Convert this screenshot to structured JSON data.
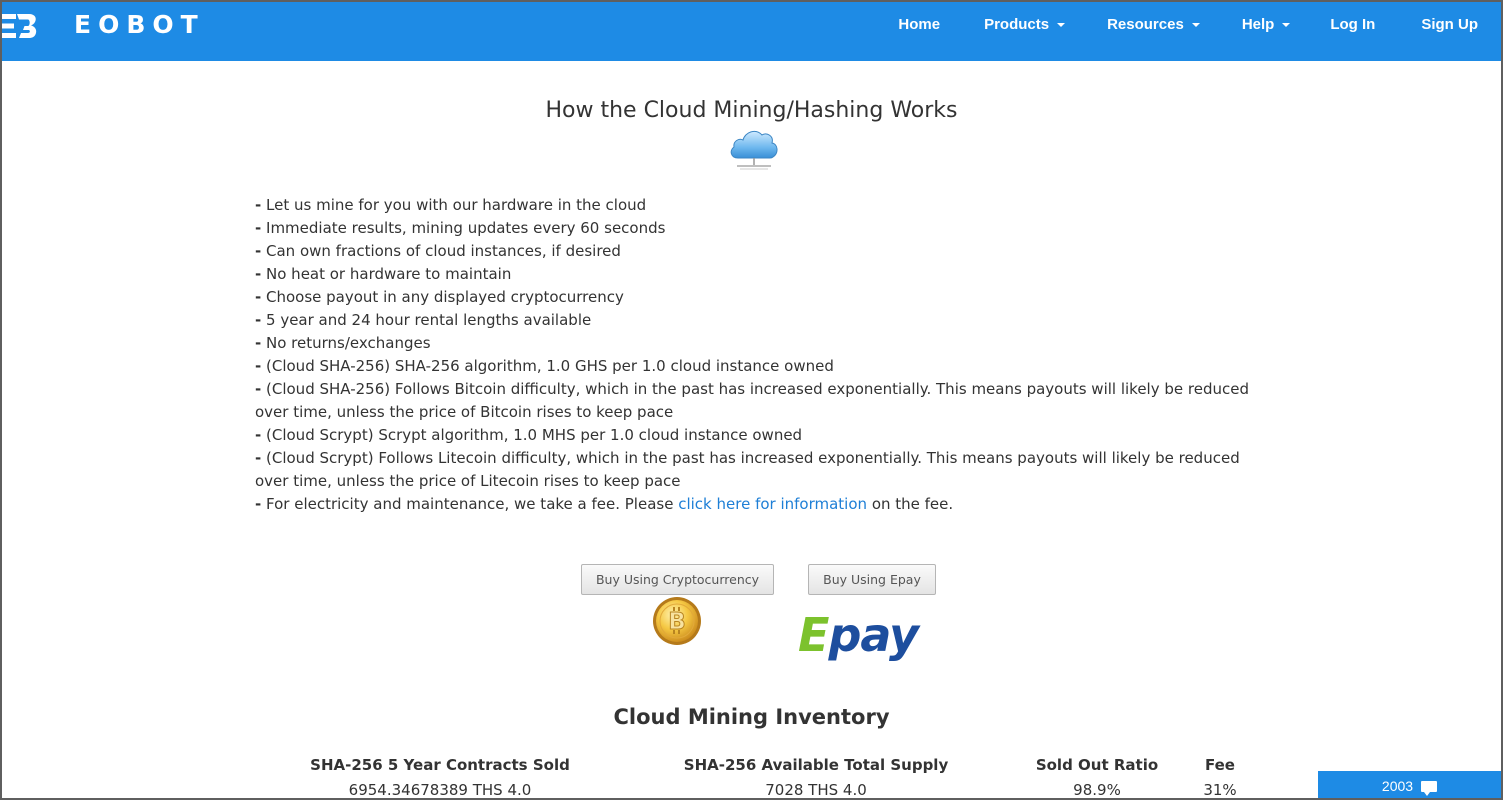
{
  "brand": {
    "logo_mark": "EB",
    "name": "EOBOT",
    "primary_color": "#1e8be5"
  },
  "nav": {
    "items": [
      {
        "label": "Home",
        "dropdown": false
      },
      {
        "label": "Products",
        "dropdown": true
      },
      {
        "label": "Resources",
        "dropdown": true
      },
      {
        "label": "Help",
        "dropdown": true
      },
      {
        "label": "Log In",
        "dropdown": false
      },
      {
        "label": "Sign Up",
        "dropdown": false
      }
    ]
  },
  "main": {
    "title": "How the Cloud Mining/Hashing Works",
    "title_icon": "cloud-network-icon",
    "features": [
      "Let us mine for you with our hardware in the cloud",
      "Immediate results, mining updates every 60 seconds",
      "Can own fractions of cloud instances, if desired",
      "No heat or hardware to maintain",
      "Choose payout in any displayed cryptocurrency",
      "5 year and 24 hour rental lengths available",
      "No returns/exchanges",
      "(Cloud SHA-256) SHA-256 algorithm, 1.0 GHS per 1.0 cloud instance owned",
      "(Cloud SHA-256) Follows Bitcoin difficulty, which in the past has increased exponentially. This means payouts will likely be reduced over time, unless the price of Bitcoin rises to keep pace",
      "(Cloud Scrypt) Scrypt algorithm, 1.0 MHS per 1.0 cloud instance owned",
      "(Cloud Scrypt) Follows Litecoin difficulty, which in the past has increased exponentially. This means payouts will likely be reduced over time, unless the price of Litecoin rises to keep pace"
    ],
    "fee_line": {
      "before": "For electricity and maintenance, we take a fee. Please ",
      "link": "click here for information",
      "after": " on the fee."
    },
    "dash": "-"
  },
  "purchase": {
    "crypto_button": "Buy Using Cryptocurrency",
    "crypto_icon": "bitcoin-icon",
    "epay_button": "Buy Using Epay",
    "epay_logo_e": "E",
    "epay_logo_pay": "pay"
  },
  "inventory": {
    "title": "Cloud Mining Inventory",
    "columns": [
      {
        "header": "SHA-256 5 Year Contracts Sold",
        "value": "6954.34678389 THS 4.0"
      },
      {
        "header": "SHA-256 Available Total Supply",
        "value": "7028 THS 4.0"
      },
      {
        "header": "Sold Out Ratio",
        "value": "98.9%"
      },
      {
        "header": "Fee",
        "value": "31%"
      }
    ]
  },
  "chat_widget": {
    "count": "2003",
    "icon": "chat-bubble-icon"
  }
}
